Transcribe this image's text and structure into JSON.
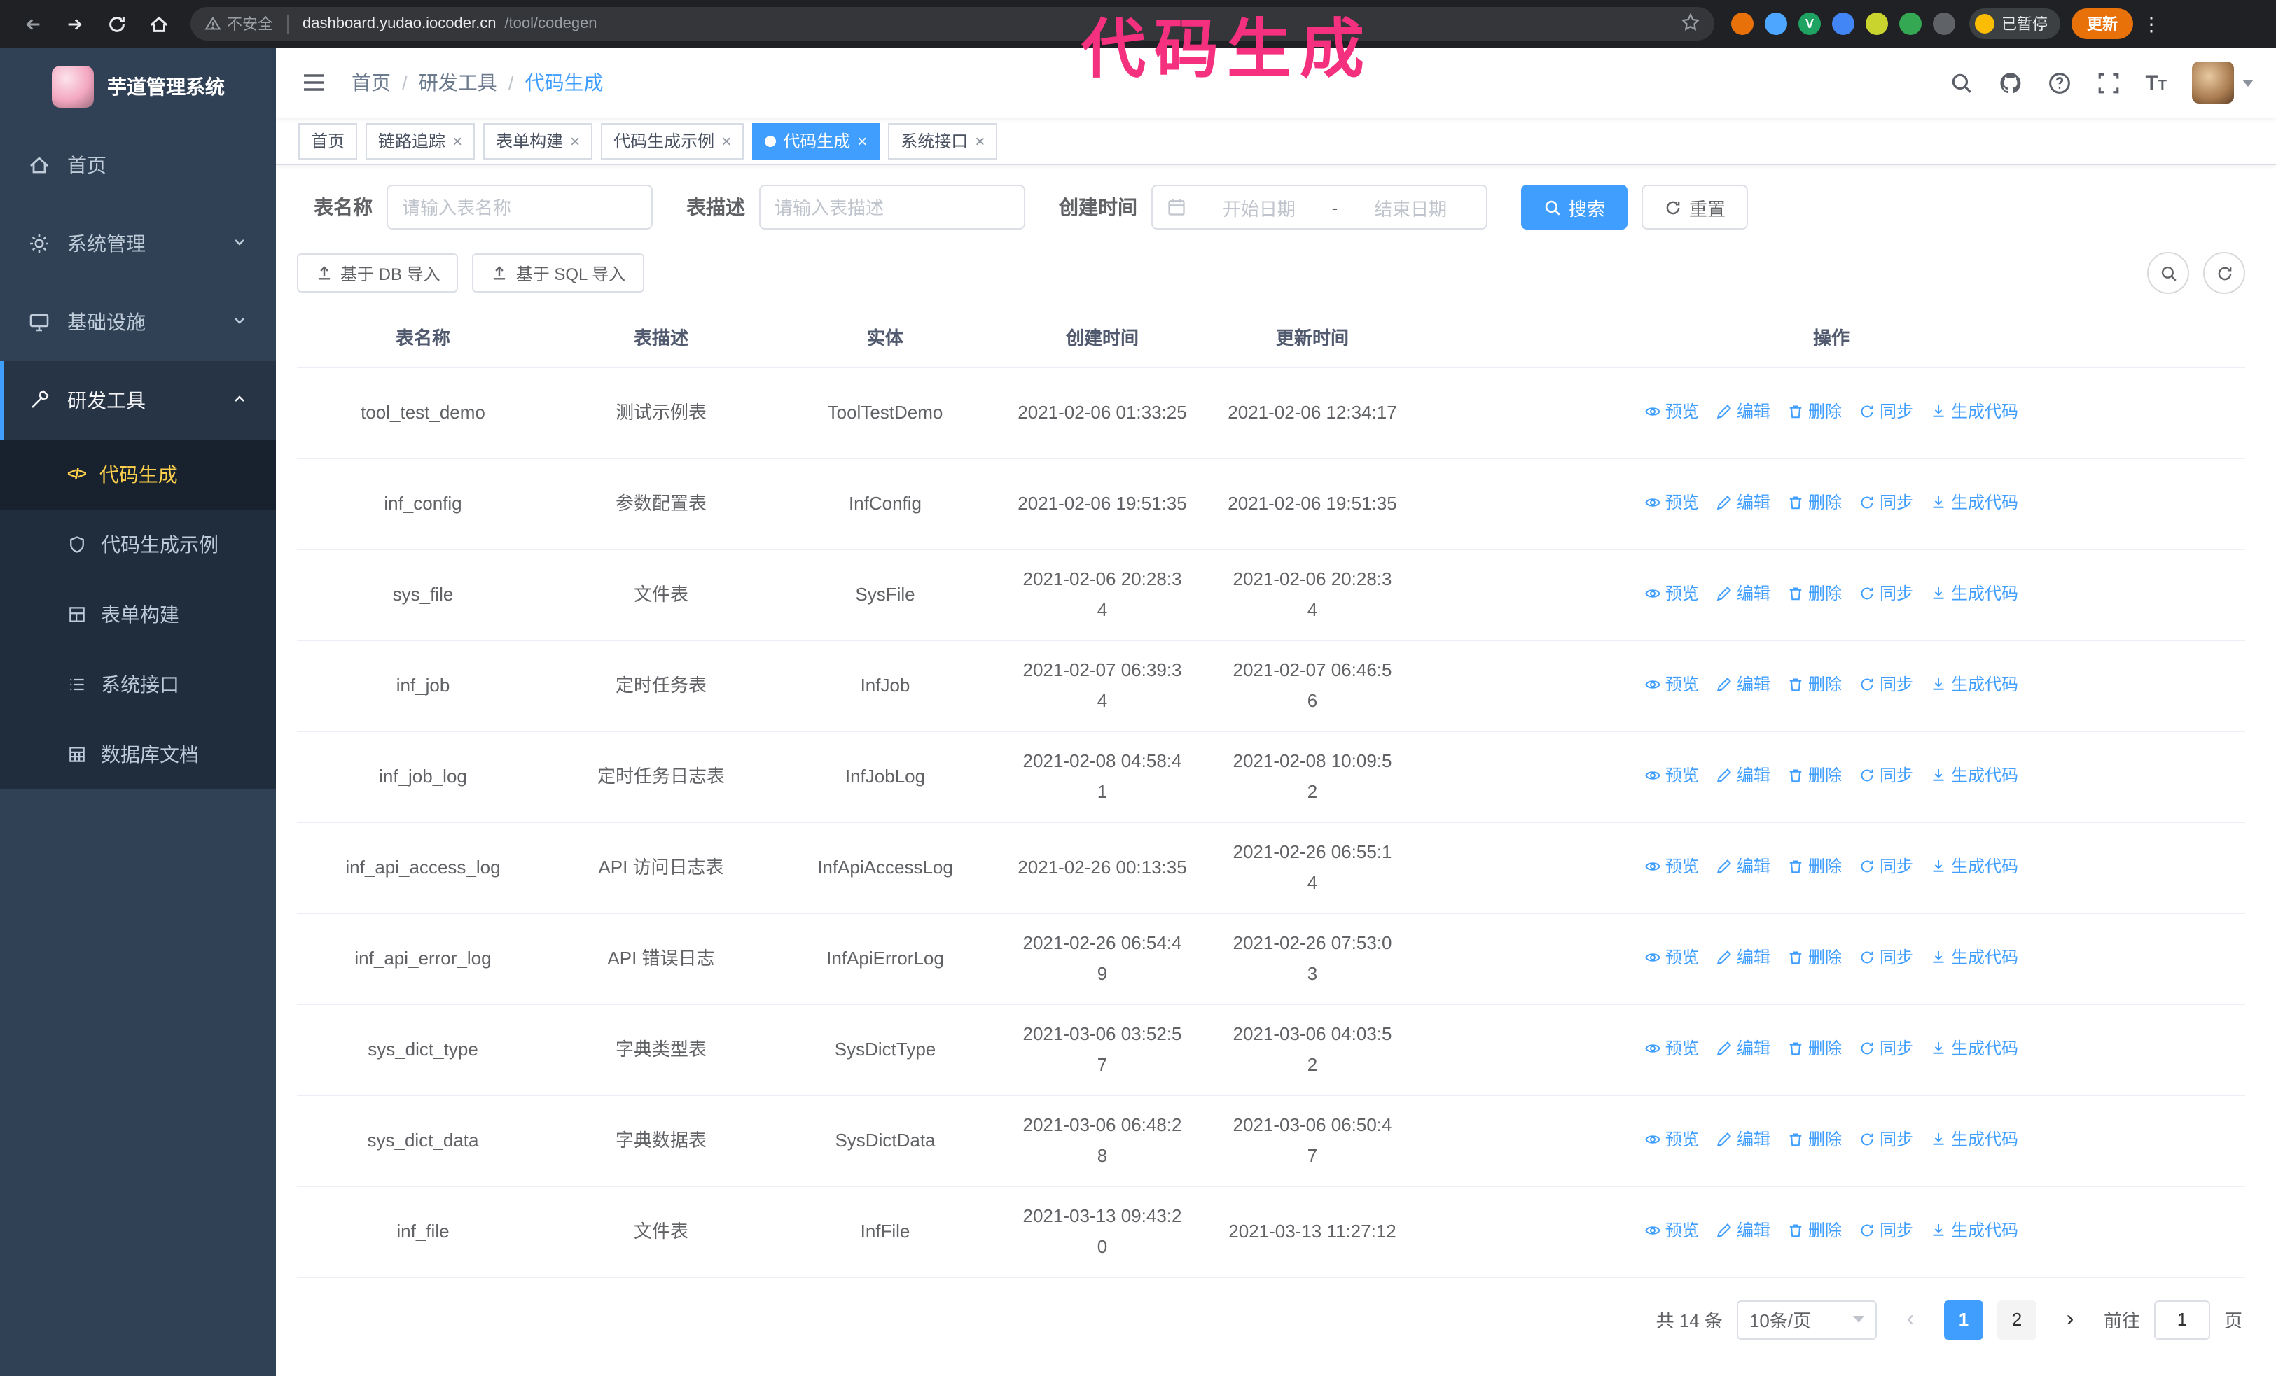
{
  "colors": {
    "accent": "#409eff",
    "annotation": "#f5317f",
    "sidebar_bg": "#304156",
    "submenu_bg": "#1f2d3d",
    "menu_active_text": "#ffd04b",
    "update_button": "#e8710a",
    "tag_active": "#409eff"
  },
  "glyphs": {
    "close": "×",
    "breadcrumb_sep": "/",
    "code": "</>",
    "dots": "⋮",
    "prev": "‹",
    "next": "›"
  },
  "browser": {
    "security_warning": "不安全",
    "url_domain": "dashboard.yudao.iocoder.cn",
    "url_path": "/tool/codegen",
    "paused_badge": "已暂停",
    "update_button": "更新"
  },
  "annotation": {
    "text": "代码生成"
  },
  "sidebar": {
    "logo_title": "芋道管理系统",
    "items": [
      {
        "label": "首页"
      },
      {
        "label": "系统管理"
      },
      {
        "label": "基础设施"
      },
      {
        "label": "研发工具"
      }
    ],
    "submenu": [
      {
        "label": "代码生成"
      },
      {
        "label": "代码生成示例"
      },
      {
        "label": "表单构建"
      },
      {
        "label": "系统接口"
      },
      {
        "label": "数据库文档"
      }
    ]
  },
  "header": {
    "breadcrumb": [
      "首页",
      "研发工具",
      "代码生成"
    ]
  },
  "tags": [
    {
      "label": "首页"
    },
    {
      "label": "链路追踪"
    },
    {
      "label": "表单构建"
    },
    {
      "label": "代码生成示例"
    },
    {
      "label": "代码生成"
    },
    {
      "label": "系统接口"
    }
  ],
  "filters": {
    "table_name_label": "表名称",
    "table_name_placeholder": "请输入表名称",
    "table_desc_label": "表描述",
    "table_desc_placeholder": "请输入表描述",
    "create_time_label": "创建时间",
    "date_start_placeholder": "开始日期",
    "date_separator": "-",
    "date_end_placeholder": "结束日期",
    "search_button": "搜索",
    "reset_button": "重置"
  },
  "toolbar": {
    "import_db": "基于 DB 导入",
    "import_sql": "基于 SQL 导入"
  },
  "table": {
    "columns": [
      "表名称",
      "表描述",
      "实体",
      "创建时间",
      "更新时间",
      "操作"
    ],
    "actions": [
      "预览",
      "编辑",
      "删除",
      "同步",
      "生成代码"
    ],
    "rows": [
      {
        "name": "tool_test_demo",
        "desc": "测试示例表",
        "entity": "ToolTestDemo",
        "created": "2021-02-06 01:33:25",
        "updated": "2021-02-06 12:34:17"
      },
      {
        "name": "inf_config",
        "desc": "参数配置表",
        "entity": "InfConfig",
        "created": "2021-02-06 19:51:35",
        "updated": "2021-02-06 19:51:35"
      },
      {
        "name": "sys_file",
        "desc": "文件表",
        "entity": "SysFile",
        "created": "2021-02-06 20:28:3\n4",
        "updated": "2021-02-06 20:28:3\n4"
      },
      {
        "name": "inf_job",
        "desc": "定时任务表",
        "entity": "InfJob",
        "created": "2021-02-07 06:39:3\n4",
        "updated": "2021-02-07 06:46:5\n6"
      },
      {
        "name": "inf_job_log",
        "desc": "定时任务日志表",
        "entity": "InfJobLog",
        "created": "2021-02-08 04:58:4\n1",
        "updated": "2021-02-08 10:09:5\n2"
      },
      {
        "name": "inf_api_access_log",
        "desc": "API 访问日志表",
        "entity": "InfApiAccessLog",
        "created": "2021-02-26 00:13:35",
        "updated": "2021-02-26 06:55:1\n4"
      },
      {
        "name": "inf_api_error_log",
        "desc": "API 错误日志",
        "entity": "InfApiErrorLog",
        "created": "2021-02-26 06:54:4\n9",
        "updated": "2021-02-26 07:53:0\n3"
      },
      {
        "name": "sys_dict_type",
        "desc": "字典类型表",
        "entity": "SysDictType",
        "created": "2021-03-06 03:52:5\n7",
        "updated": "2021-03-06 04:03:5\n2"
      },
      {
        "name": "sys_dict_data",
        "desc": "字典数据表",
        "entity": "SysDictData",
        "created": "2021-03-06 06:48:2\n8",
        "updated": "2021-03-06 06:50:4\n7"
      },
      {
        "name": "inf_file",
        "desc": "文件表",
        "entity": "InfFile",
        "created": "2021-03-13 09:43:2\n0",
        "updated": "2021-03-13 11:27:12"
      }
    ]
  },
  "pagination": {
    "total": "共 14 条",
    "page_size": "10条/页",
    "pages": [
      "1",
      "2"
    ],
    "goto_label": "前往",
    "goto_value": "1",
    "goto_suffix": "页"
  }
}
